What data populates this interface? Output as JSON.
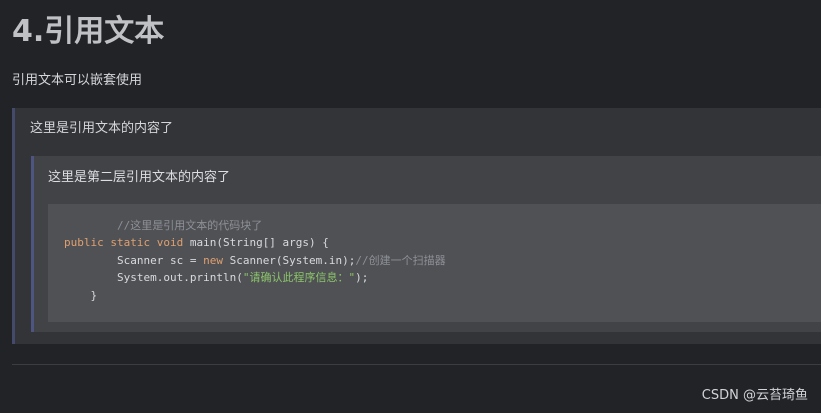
{
  "heading": "4.引用文本",
  "intro": "引用文本可以嵌套使用",
  "quote_level1": "这里是引用文本的内容了",
  "quote_level2": "这里是第二层引用文本的内容了",
  "code": {
    "line1_comment": "//这里是引用文本的代码块了",
    "line2_kw": "public static void",
    "line2_rest": " main(String[] args) {",
    "line3_a": "Scanner sc = ",
    "line3_kw": "new",
    "line3_b": " Scanner(System.in);",
    "line3_comment": "//创建一个扫描器",
    "line4_a": "System.out.println(",
    "line4_str": "\"请确认此程序信息：\"",
    "line4_b": ");",
    "line5": "}"
  },
  "watermark": "CSDN @云苔琦鱼"
}
